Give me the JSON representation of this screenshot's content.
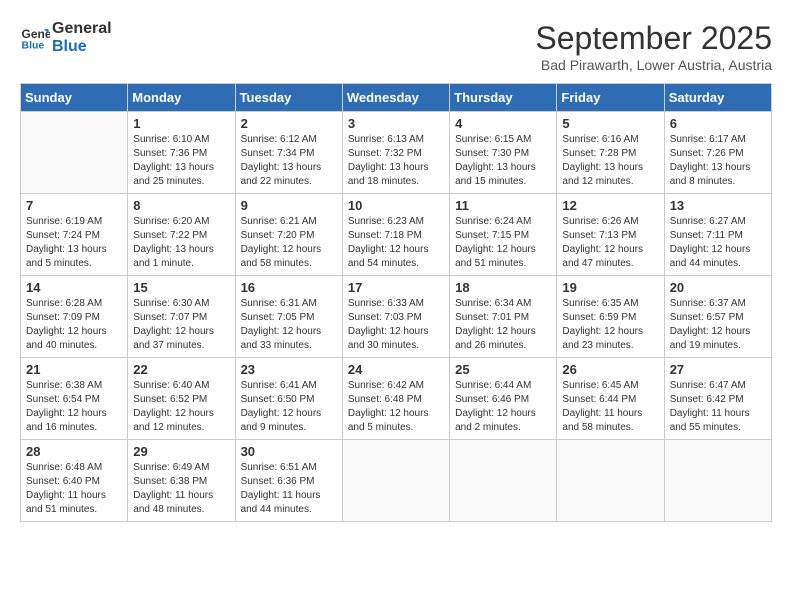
{
  "logo": {
    "line1": "General",
    "line2": "Blue"
  },
  "title": "September 2025",
  "subtitle": "Bad Pirawarth, Lower Austria, Austria",
  "days_of_week": [
    "Sunday",
    "Monday",
    "Tuesday",
    "Wednesday",
    "Thursday",
    "Friday",
    "Saturday"
  ],
  "weeks": [
    [
      {
        "num": "",
        "detail": ""
      },
      {
        "num": "1",
        "detail": "Sunrise: 6:10 AM\nSunset: 7:36 PM\nDaylight: 13 hours\nand 25 minutes."
      },
      {
        "num": "2",
        "detail": "Sunrise: 6:12 AM\nSunset: 7:34 PM\nDaylight: 13 hours\nand 22 minutes."
      },
      {
        "num": "3",
        "detail": "Sunrise: 6:13 AM\nSunset: 7:32 PM\nDaylight: 13 hours\nand 18 minutes."
      },
      {
        "num": "4",
        "detail": "Sunrise: 6:15 AM\nSunset: 7:30 PM\nDaylight: 13 hours\nand 15 minutes."
      },
      {
        "num": "5",
        "detail": "Sunrise: 6:16 AM\nSunset: 7:28 PM\nDaylight: 13 hours\nand 12 minutes."
      },
      {
        "num": "6",
        "detail": "Sunrise: 6:17 AM\nSunset: 7:26 PM\nDaylight: 13 hours\nand 8 minutes."
      }
    ],
    [
      {
        "num": "7",
        "detail": "Sunrise: 6:19 AM\nSunset: 7:24 PM\nDaylight: 13 hours\nand 5 minutes."
      },
      {
        "num": "8",
        "detail": "Sunrise: 6:20 AM\nSunset: 7:22 PM\nDaylight: 13 hours\nand 1 minute."
      },
      {
        "num": "9",
        "detail": "Sunrise: 6:21 AM\nSunset: 7:20 PM\nDaylight: 12 hours\nand 58 minutes."
      },
      {
        "num": "10",
        "detail": "Sunrise: 6:23 AM\nSunset: 7:18 PM\nDaylight: 12 hours\nand 54 minutes."
      },
      {
        "num": "11",
        "detail": "Sunrise: 6:24 AM\nSunset: 7:15 PM\nDaylight: 12 hours\nand 51 minutes."
      },
      {
        "num": "12",
        "detail": "Sunrise: 6:26 AM\nSunset: 7:13 PM\nDaylight: 12 hours\nand 47 minutes."
      },
      {
        "num": "13",
        "detail": "Sunrise: 6:27 AM\nSunset: 7:11 PM\nDaylight: 12 hours\nand 44 minutes."
      }
    ],
    [
      {
        "num": "14",
        "detail": "Sunrise: 6:28 AM\nSunset: 7:09 PM\nDaylight: 12 hours\nand 40 minutes."
      },
      {
        "num": "15",
        "detail": "Sunrise: 6:30 AM\nSunset: 7:07 PM\nDaylight: 12 hours\nand 37 minutes."
      },
      {
        "num": "16",
        "detail": "Sunrise: 6:31 AM\nSunset: 7:05 PM\nDaylight: 12 hours\nand 33 minutes."
      },
      {
        "num": "17",
        "detail": "Sunrise: 6:33 AM\nSunset: 7:03 PM\nDaylight: 12 hours\nand 30 minutes."
      },
      {
        "num": "18",
        "detail": "Sunrise: 6:34 AM\nSunset: 7:01 PM\nDaylight: 12 hours\nand 26 minutes."
      },
      {
        "num": "19",
        "detail": "Sunrise: 6:35 AM\nSunset: 6:59 PM\nDaylight: 12 hours\nand 23 minutes."
      },
      {
        "num": "20",
        "detail": "Sunrise: 6:37 AM\nSunset: 6:57 PM\nDaylight: 12 hours\nand 19 minutes."
      }
    ],
    [
      {
        "num": "21",
        "detail": "Sunrise: 6:38 AM\nSunset: 6:54 PM\nDaylight: 12 hours\nand 16 minutes."
      },
      {
        "num": "22",
        "detail": "Sunrise: 6:40 AM\nSunset: 6:52 PM\nDaylight: 12 hours\nand 12 minutes."
      },
      {
        "num": "23",
        "detail": "Sunrise: 6:41 AM\nSunset: 6:50 PM\nDaylight: 12 hours\nand 9 minutes."
      },
      {
        "num": "24",
        "detail": "Sunrise: 6:42 AM\nSunset: 6:48 PM\nDaylight: 12 hours\nand 5 minutes."
      },
      {
        "num": "25",
        "detail": "Sunrise: 6:44 AM\nSunset: 6:46 PM\nDaylight: 12 hours\nand 2 minutes."
      },
      {
        "num": "26",
        "detail": "Sunrise: 6:45 AM\nSunset: 6:44 PM\nDaylight: 11 hours\nand 58 minutes."
      },
      {
        "num": "27",
        "detail": "Sunrise: 6:47 AM\nSunset: 6:42 PM\nDaylight: 11 hours\nand 55 minutes."
      }
    ],
    [
      {
        "num": "28",
        "detail": "Sunrise: 6:48 AM\nSunset: 6:40 PM\nDaylight: 11 hours\nand 51 minutes."
      },
      {
        "num": "29",
        "detail": "Sunrise: 6:49 AM\nSunset: 6:38 PM\nDaylight: 11 hours\nand 48 minutes."
      },
      {
        "num": "30",
        "detail": "Sunrise: 6:51 AM\nSunset: 6:36 PM\nDaylight: 11 hours\nand 44 minutes."
      },
      {
        "num": "",
        "detail": ""
      },
      {
        "num": "",
        "detail": ""
      },
      {
        "num": "",
        "detail": ""
      },
      {
        "num": "",
        "detail": ""
      }
    ]
  ]
}
